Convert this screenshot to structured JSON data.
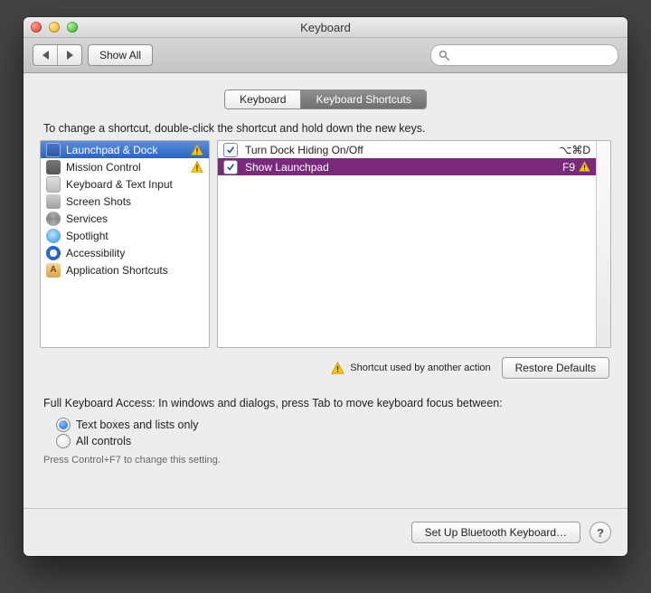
{
  "window": {
    "title": "Keyboard"
  },
  "toolbar": {
    "show_all": "Show All",
    "search_placeholder": ""
  },
  "tabs": {
    "keyboard": "Keyboard",
    "shortcuts": "Keyboard Shortcuts"
  },
  "instruction": "To change a shortcut, double-click the shortcut and hold down the new keys.",
  "categories": [
    {
      "label": "Launchpad & Dock",
      "selected": true,
      "warn": true,
      "icon": "launchpad"
    },
    {
      "label": "Mission Control",
      "warn": true,
      "icon": "mission"
    },
    {
      "label": "Keyboard & Text Input",
      "icon": "kbtext"
    },
    {
      "label": "Screen Shots",
      "icon": "screen"
    },
    {
      "label": "Services",
      "icon": "services"
    },
    {
      "label": "Spotlight",
      "icon": "spot"
    },
    {
      "label": "Accessibility",
      "icon": "acc"
    },
    {
      "label": "Application Shortcuts",
      "icon": "app"
    }
  ],
  "shortcuts": [
    {
      "name": "Turn Dock Hiding On/Off",
      "key": "⌥⌘D",
      "checked": true,
      "selected": false,
      "warn": false
    },
    {
      "name": "Show Launchpad",
      "key": "F9",
      "checked": true,
      "selected": true,
      "warn": true
    }
  ],
  "conflict_note": "Shortcut used by another action",
  "restore_defaults": "Restore Defaults",
  "fka": {
    "intro": "Full Keyboard Access: In windows and dialogs, press Tab to move keyboard focus between:",
    "opt1": "Text boxes and lists only",
    "opt2": "All controls",
    "hint": "Press Control+F7 to change this setting."
  },
  "footer": {
    "bluetooth": "Set Up Bluetooth Keyboard…"
  }
}
